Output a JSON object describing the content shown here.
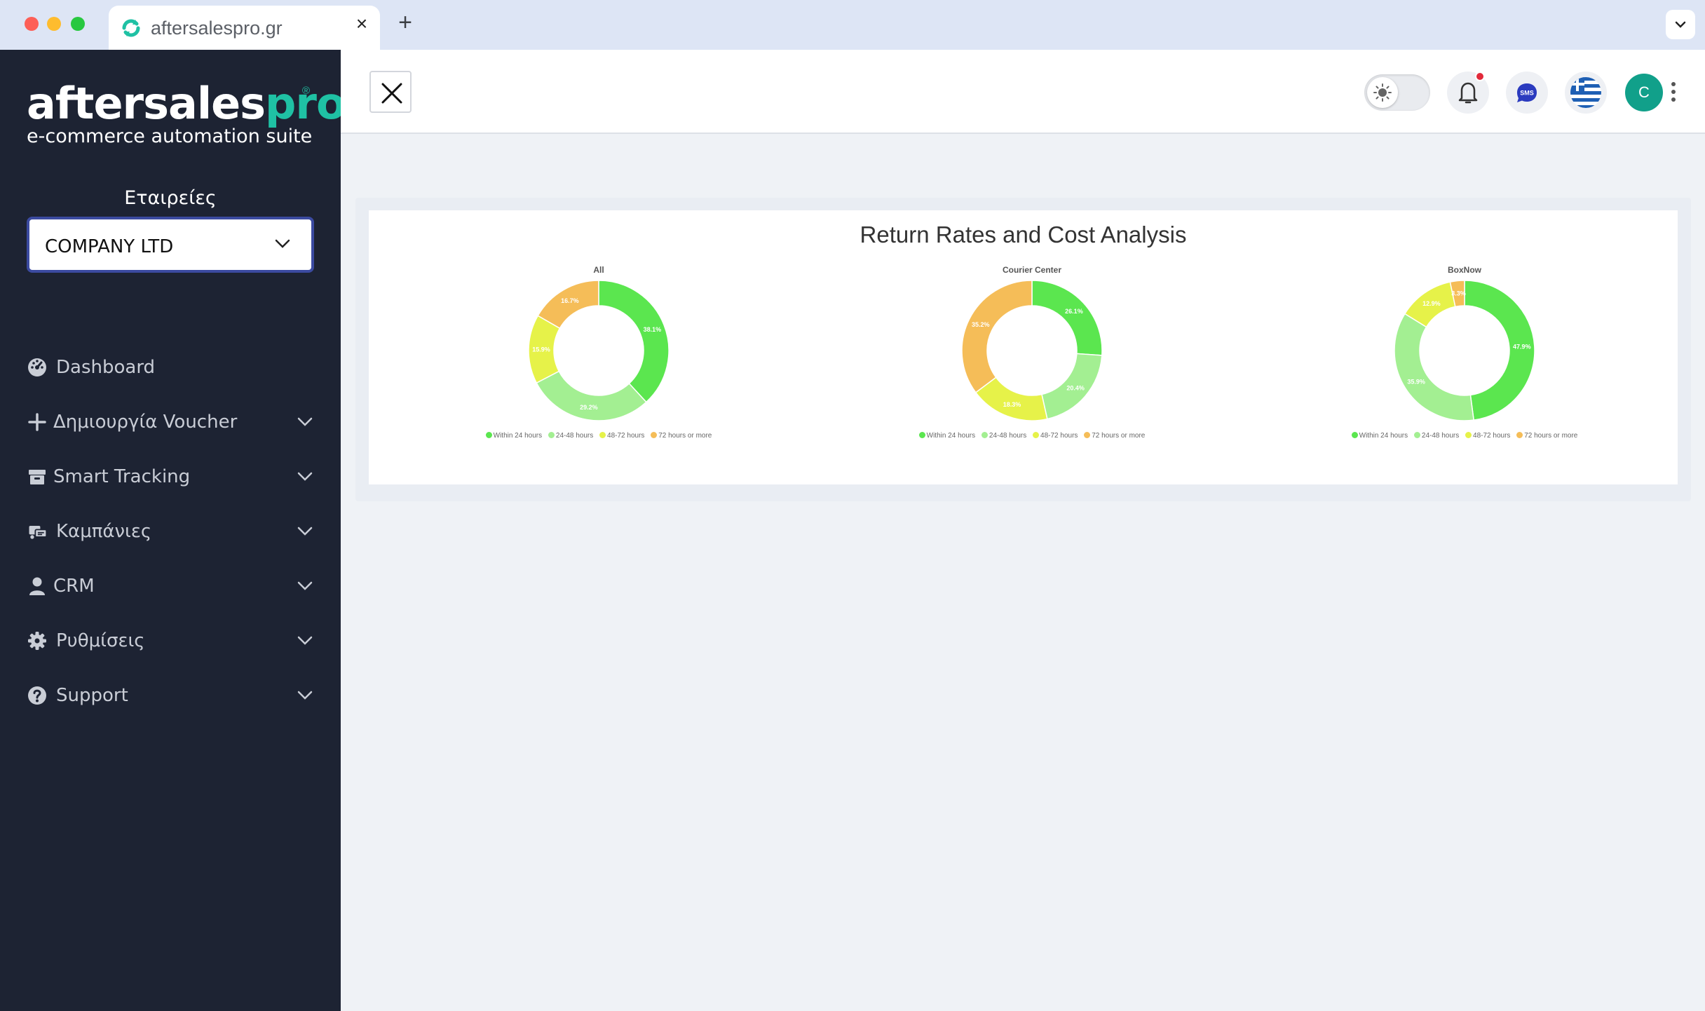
{
  "browser": {
    "tab_title": "aftersalespro.gr",
    "new_tab_label": "+",
    "close_tab_label": "×"
  },
  "sidebar": {
    "logo_main": "aftersales",
    "logo_accent": "pro",
    "logo_registered": "®",
    "tagline": "e-commerce automation suite",
    "companies_label": "Εταιρείες",
    "company_selected": "COMPANY LTD",
    "items": [
      {
        "label": "Dashboard",
        "icon": "dashboard-gauge-icon",
        "has_chevron": false
      },
      {
        "label": "Δημιουργία Voucher",
        "icon": "plus-icon",
        "has_chevron": true
      },
      {
        "label": "Smart Tracking",
        "icon": "box-icon",
        "has_chevron": true
      },
      {
        "label": "Καμπάνιες",
        "icon": "shipping-campaign-icon",
        "has_chevron": true
      },
      {
        "label": "CRM",
        "icon": "user-icon",
        "has_chevron": true
      },
      {
        "label": "Ρυθμίσεις",
        "icon": "gear-icon",
        "has_chevron": true
      },
      {
        "label": "Support",
        "icon": "question-circle-icon",
        "has_chevron": true
      }
    ]
  },
  "topbar": {
    "sms_label": "SMS",
    "avatar_initial": "C"
  },
  "colors": {
    "within_24": "#5be64f",
    "h24_48": "#a3ef92",
    "h48_72": "#e6f249",
    "h72_more": "#f5bd58",
    "brand_accent": "#1fc1a4",
    "sidebar_bg": "#1d2333"
  },
  "chart_data": {
    "type": "pie",
    "title": "Return Rates and Cost Analysis",
    "legend": [
      "Within 24 hours",
      "24-48 hours",
      "48-72 hours",
      "72 hours or more"
    ],
    "charts": [
      {
        "name": "All",
        "values": [
          38.1,
          29.2,
          15.9,
          16.7
        ],
        "labels": [
          "38.1%",
          "29.2%",
          "15.9%",
          "16.7%"
        ]
      },
      {
        "name": "Courier Center",
        "values": [
          26.1,
          20.4,
          18.3,
          35.2
        ],
        "labels": [
          "26.1%",
          "20.4%",
          "18.3%",
          "35.2%"
        ]
      },
      {
        "name": "BoxNow",
        "values": [
          47.9,
          35.9,
          12.9,
          3.3
        ],
        "labels": [
          "47.9%",
          "35.9%",
          "12.9%",
          "3.3%"
        ]
      }
    ]
  }
}
